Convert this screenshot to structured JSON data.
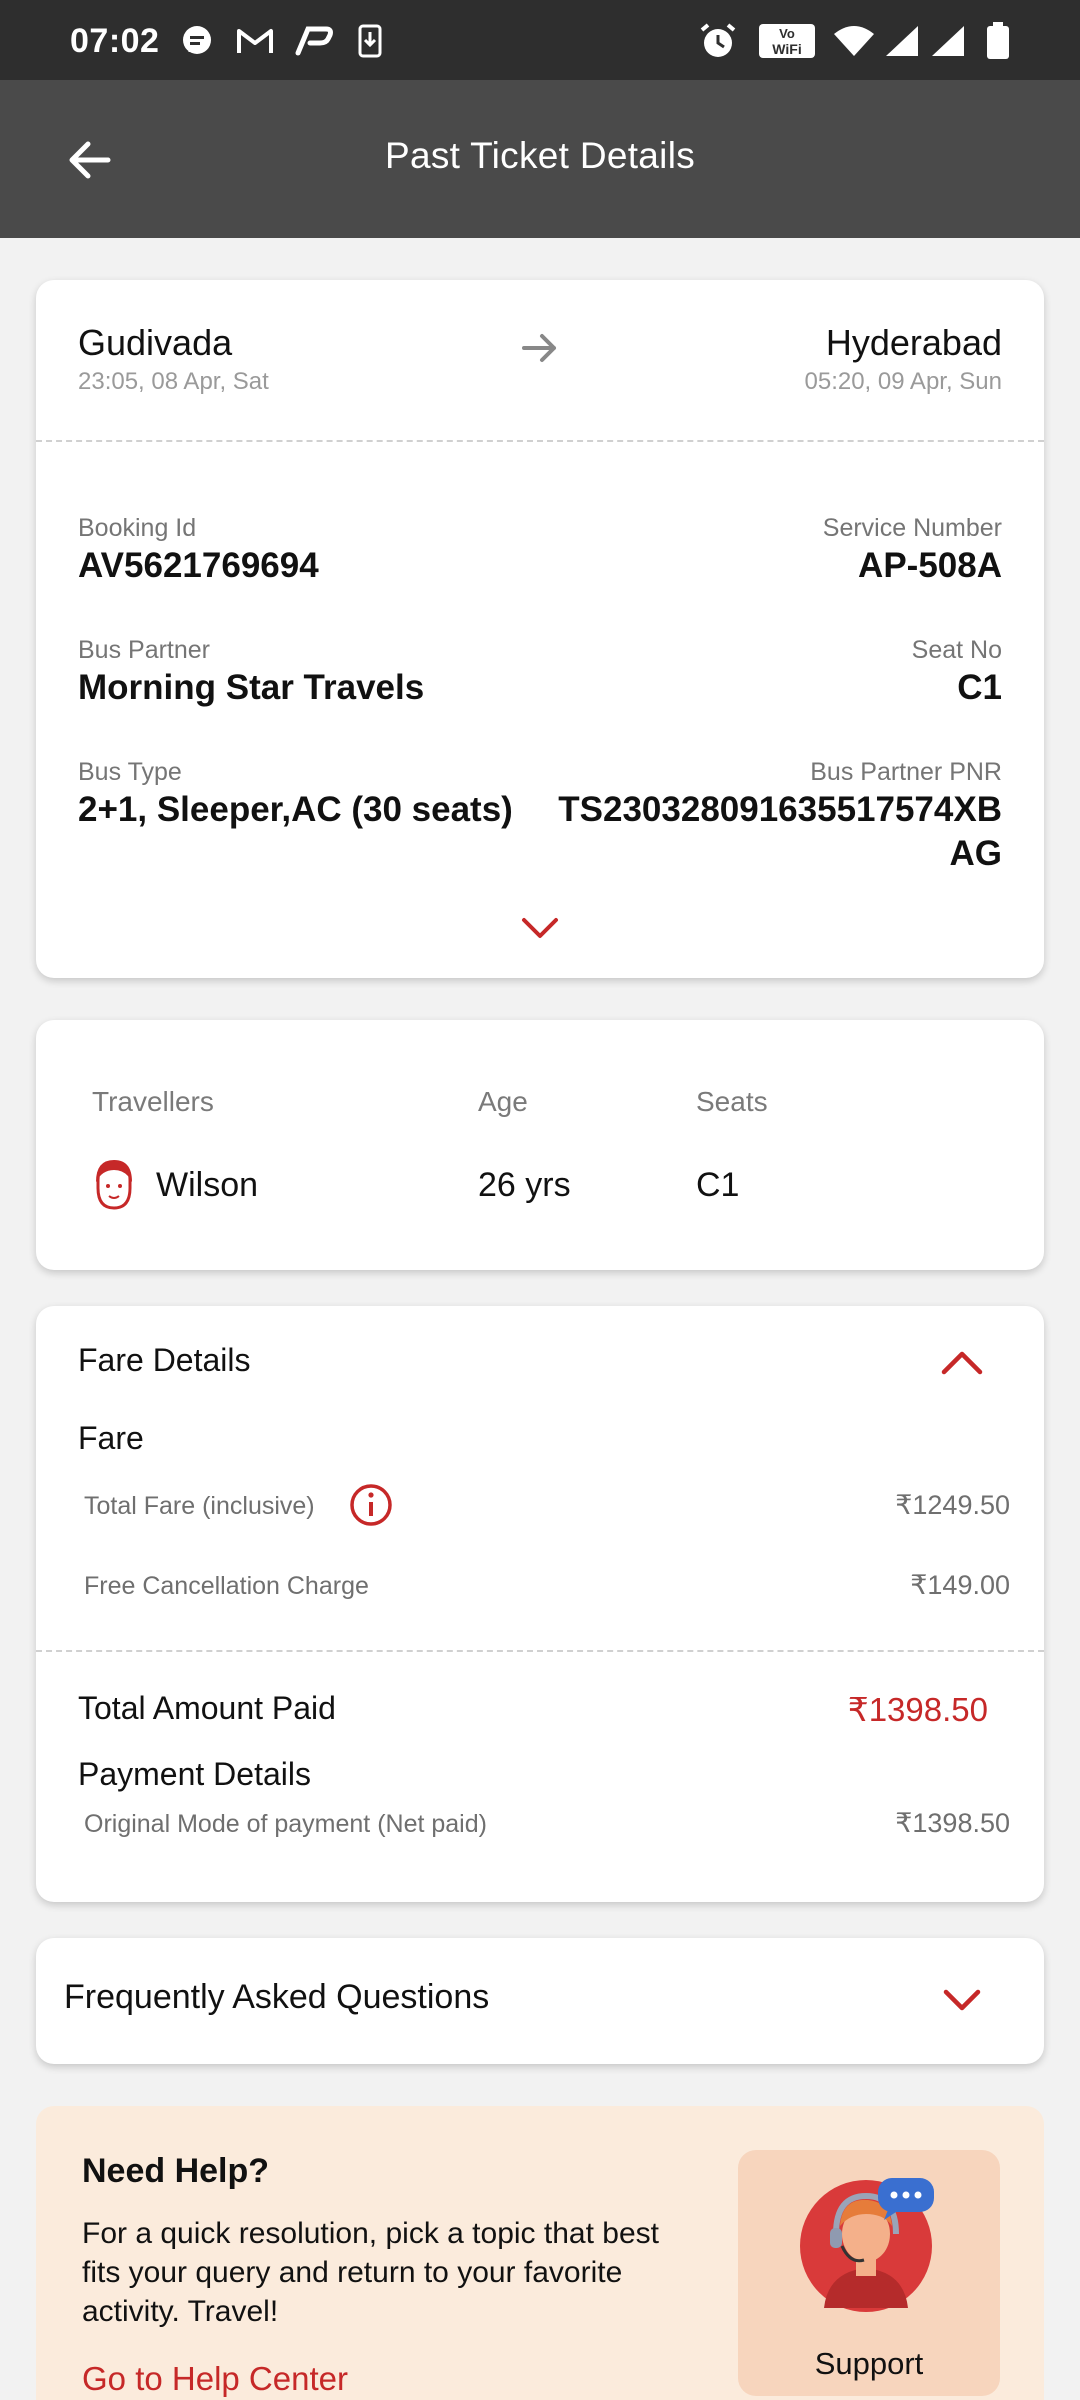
{
  "status_bar": {
    "time": "07:02",
    "notification_icons": [
      "message-icon",
      "gmail-icon",
      "payments-icon",
      "download-icon"
    ],
    "system_icons": [
      "alarm-icon",
      "vowifi-icon",
      "wifi-icon",
      "signal-icon",
      "battery-icon"
    ],
    "vowifi_text": "Vo WiFi"
  },
  "app_bar": {
    "title": "Past Ticket Details"
  },
  "journey": {
    "from_city": "Gudivada",
    "from_time": "23:05, 08 Apr, Sat",
    "to_city": "Hyderabad",
    "to_time": "05:20, 09 Apr, Sun"
  },
  "booking": {
    "booking_id_label": "Booking Id",
    "booking_id": "AV5621769694",
    "service_number_label": "Service Number",
    "service_number": "AP-508A",
    "bus_partner_label": "Bus Partner",
    "bus_partner": "Morning Star Travels",
    "seat_no_label": "Seat No",
    "seat_no": "C1",
    "bus_type_label": "Bus Type",
    "bus_type": "2+1, Sleeper,AC (30 seats)",
    "pnr_label": "Bus Partner PNR",
    "pnr_line1": "TS230328091635517574XB",
    "pnr_line2": "AG"
  },
  "travellers": {
    "headers": {
      "name": "Travellers",
      "age": "Age",
      "seats": "Seats"
    },
    "rows": [
      {
        "name": "Wilson",
        "age": "26 yrs",
        "seats": "C1"
      }
    ]
  },
  "fare": {
    "heading": "Fare Details",
    "fare_label": "Fare",
    "total_fare_label": "Total Fare (inclusive)",
    "total_fare": "₹1249.50",
    "cancellation_label": "Free Cancellation Charge",
    "cancellation": "₹149.00",
    "total_paid_label": "Total Amount Paid",
    "total_paid": "₹1398.50",
    "payment_heading": "Payment Details",
    "payment_mode_label": "Original Mode of payment (Net paid)",
    "payment_amount": "₹1398.50"
  },
  "faq": {
    "title": "Frequently Asked Questions"
  },
  "help": {
    "title": "Need Help?",
    "text": "For a quick resolution, pick a topic that best fits your query and return to your favorite activity. Travel!",
    "link": "Go to Help Center",
    "support_label": "Support"
  },
  "colors": {
    "accent": "#c62828",
    "app_bar": "#4a4a4a",
    "status_bar": "#2e2e2e",
    "help_bg": "#fbebdc"
  }
}
